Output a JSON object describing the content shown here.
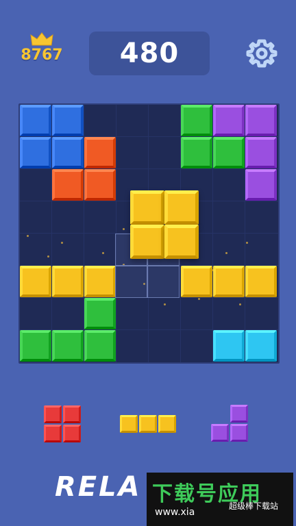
{
  "header": {
    "best_score": "8767",
    "score": "480",
    "crown_icon": "crown-icon",
    "settings_icon": "gear-icon"
  },
  "colors": {
    "blue": "#2f6fe0",
    "orange": "#f05a24",
    "green": "#2fbf3d",
    "purple": "#9a4fe0",
    "yellow": "#f7c21f",
    "cyan": "#2ec6f2",
    "red": "#e83a3a"
  },
  "board": {
    "rows": 8,
    "cols": 8,
    "cells": [
      [
        0,
        0,
        "blue"
      ],
      [
        0,
        1,
        "blue"
      ],
      [
        0,
        5,
        "green"
      ],
      [
        0,
        6,
        "purple"
      ],
      [
        0,
        7,
        "purple"
      ],
      [
        1,
        0,
        "blue"
      ],
      [
        1,
        1,
        "blue"
      ],
      [
        1,
        2,
        "orange"
      ],
      [
        1,
        5,
        "green"
      ],
      [
        1,
        6,
        "green"
      ],
      [
        1,
        7,
        "purple"
      ],
      [
        2,
        1,
        "orange"
      ],
      [
        2,
        2,
        "orange"
      ],
      [
        2,
        7,
        "purple"
      ],
      [
        5,
        0,
        "yellow"
      ],
      [
        5,
        1,
        "yellow"
      ],
      [
        5,
        2,
        "yellow"
      ],
      [
        5,
        5,
        "yellow"
      ],
      [
        5,
        6,
        "yellow"
      ],
      [
        5,
        7,
        "yellow"
      ],
      [
        6,
        2,
        "green"
      ],
      [
        7,
        0,
        "green"
      ],
      [
        7,
        1,
        "green"
      ],
      [
        7,
        2,
        "green"
      ],
      [
        7,
        6,
        "cyan"
      ],
      [
        7,
        7,
        "cyan"
      ]
    ],
    "dragging_piece": {
      "color": "yellow",
      "shape": "2x2"
    },
    "ghost_cells": [
      [
        4,
        3
      ],
      [
        4,
        4
      ],
      [
        5,
        3
      ],
      [
        5,
        4
      ]
    ]
  },
  "tray": [
    {
      "name": "tray-piece-red-square",
      "color": "red",
      "cells": [
        [
          0,
          0
        ],
        [
          0,
          1
        ],
        [
          1,
          0
        ],
        [
          1,
          1
        ]
      ]
    },
    {
      "name": "tray-piece-yellow-line",
      "color": "yellow",
      "cells": [
        [
          0,
          0
        ],
        [
          0,
          1
        ],
        [
          0,
          2
        ]
      ]
    },
    {
      "name": "tray-piece-purple-l",
      "color": "purple",
      "cells": [
        [
          0,
          1
        ],
        [
          1,
          0
        ],
        [
          1,
          1
        ]
      ]
    }
  ],
  "banner_text": "RELA",
  "watermark": {
    "title": "下载号应用",
    "url": "www.xia",
    "site": "超级棒下载站"
  }
}
